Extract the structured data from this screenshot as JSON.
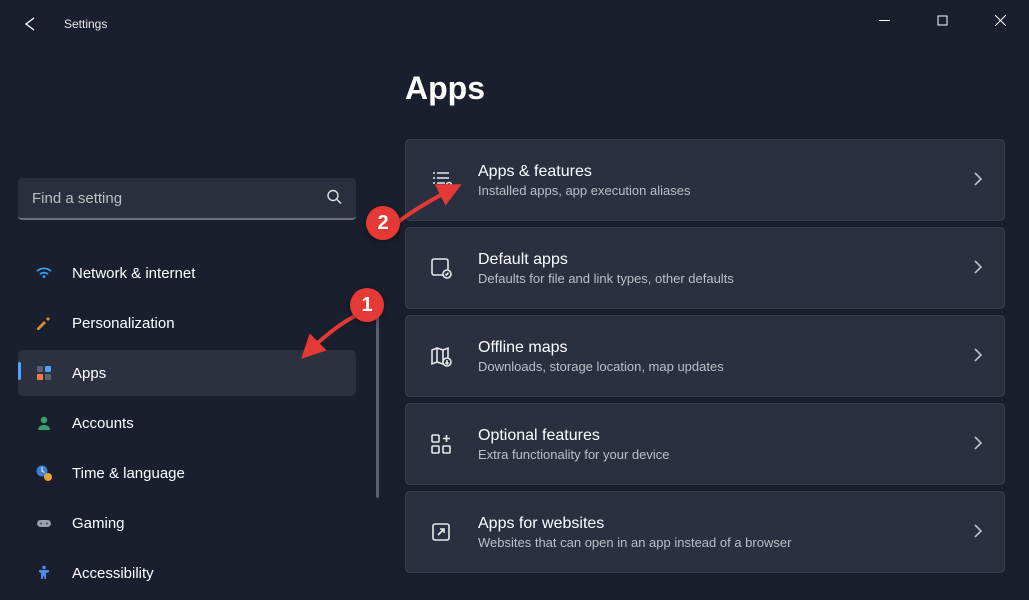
{
  "app": {
    "title": "Settings"
  },
  "search": {
    "placeholder": "Find a setting"
  },
  "page": {
    "title": "Apps"
  },
  "sidebar": {
    "items": [
      {
        "label": "Network & internet"
      },
      {
        "label": "Personalization"
      },
      {
        "label": "Apps"
      },
      {
        "label": "Accounts"
      },
      {
        "label": "Time & language"
      },
      {
        "label": "Gaming"
      },
      {
        "label": "Accessibility"
      }
    ]
  },
  "cards": [
    {
      "title": "Apps & features",
      "sub": "Installed apps, app execution aliases"
    },
    {
      "title": "Default apps",
      "sub": "Defaults for file and link types, other defaults"
    },
    {
      "title": "Offline maps",
      "sub": "Downloads, storage location, map updates"
    },
    {
      "title": "Optional features",
      "sub": "Extra functionality for your device"
    },
    {
      "title": "Apps for websites",
      "sub": "Websites that can open in an app instead of a browser"
    }
  ],
  "annotations": [
    {
      "num": "1"
    },
    {
      "num": "2"
    }
  ]
}
